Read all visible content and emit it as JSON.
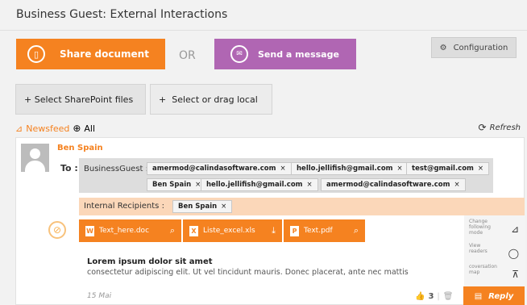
{
  "header": {
    "title": "Business Guest: External Interactions"
  },
  "actions": {
    "share_label": "Share document",
    "or_label": "OR",
    "message_label": "Send a message",
    "config_label": "Configuration"
  },
  "select": {
    "sharepoint_label": "Select SharePoint files",
    "local_label": "Select or drag local"
  },
  "feed": {
    "newsfeed_label": "Newsfeed",
    "all_label": "All",
    "refresh_label": "Refresh"
  },
  "post": {
    "author": "Ben Spain",
    "to_label": "To :",
    "business_guest_label": "BusinessGuest :",
    "business_guest_chips": [
      "amermod@calindasoftware.com",
      "hello.jellifish@gmail.com",
      "test@gmail.com",
      "Ben Spain",
      "hello.jellifish@gmail.com",
      "amermod@calindasoftware.com"
    ],
    "internal_label": "Internal Recipients :",
    "internal_chips": [
      "Ben Spain"
    ],
    "chip_remove": "×",
    "files": [
      {
        "name": "Text_here.doc",
        "type": "W"
      },
      {
        "name": "Liste_excel.xls",
        "type": "X"
      },
      {
        "name": "Text.pdf",
        "type": "P"
      }
    ],
    "title": "Lorem ipsum dolor sit amet",
    "body": "consectetur adipiscing elit. Ut vel tincidunt mauris. Donec placerat, ante nec mattis",
    "date": "15 Mai",
    "likes": "3",
    "side": {
      "change_mode": "Change following mode",
      "view_readers": "View readers",
      "conversation_map": "coversation map"
    },
    "reply_label": "Reply"
  },
  "colors": {
    "orange": "#f58220",
    "purple": "#b066b3",
    "peach": "#fbd7b9"
  }
}
